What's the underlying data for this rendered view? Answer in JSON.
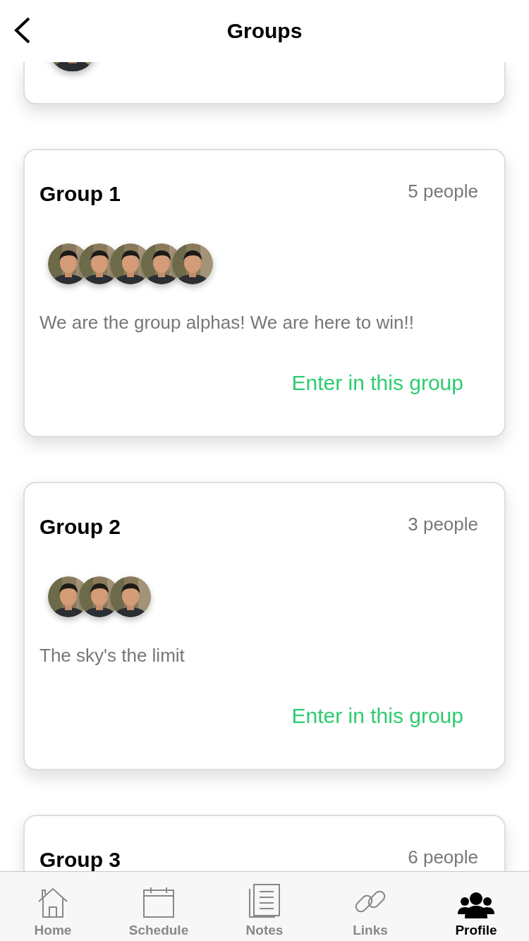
{
  "header": {
    "title": "Groups"
  },
  "groups": [
    {
      "name": "Group 1",
      "count": "5 people",
      "description": "We are the group alphas! We are here to win!!",
      "action": "Enter in this group"
    },
    {
      "name": "Group 2",
      "count": "3 people",
      "description": "The sky's the limit",
      "action": "Enter in this group"
    },
    {
      "name": "Group 3",
      "count": "6 people"
    }
  ],
  "tabs": [
    {
      "label": "Home",
      "selected": false
    },
    {
      "label": "Schedule",
      "selected": false
    },
    {
      "label": "Notes",
      "selected": false
    },
    {
      "label": "Links",
      "selected": false
    },
    {
      "label": "Profile",
      "selected": true
    }
  ]
}
